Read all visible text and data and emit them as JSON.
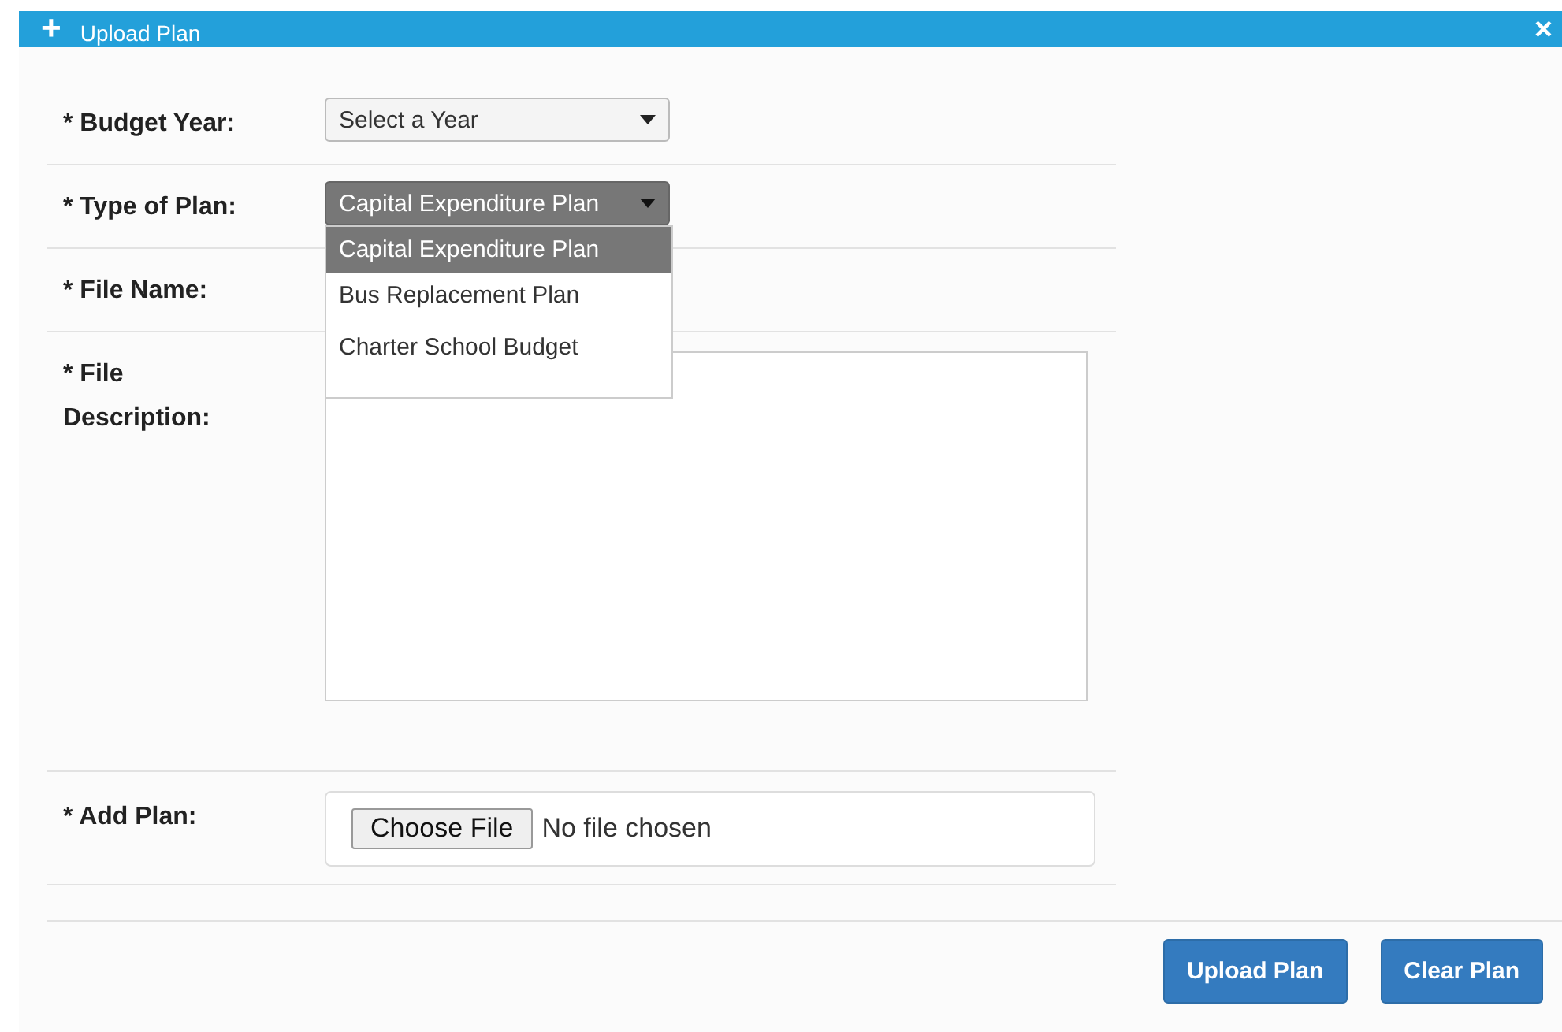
{
  "dialog": {
    "title": "Upload Plan",
    "title_icon": "+",
    "close": "×"
  },
  "fields": [
    {
      "kind": "select",
      "label": "* Budget Year:",
      "value": "Select a Year",
      "open": false
    },
    {
      "kind": "select",
      "label": "* Type of Plan:",
      "value": "Capital Expenditure Plan",
      "open": true,
      "options": [
        {
          "label": "Capital Expenditure Plan",
          "selected": true
        },
        {
          "label": "Bus Replacement Plan",
          "selected": false
        },
        {
          "label": "Charter School Budget",
          "selected": false
        }
      ]
    },
    {
      "kind": "text",
      "label": "* File Name:"
    },
    {
      "kind": "textarea",
      "label": "* File Description:"
    },
    {
      "kind": "file",
      "label": "* Add Plan:",
      "button": "Choose File",
      "status": "No file chosen"
    }
  ],
  "buttons": [
    "Upload Plan",
    "Clear Plan"
  ]
}
